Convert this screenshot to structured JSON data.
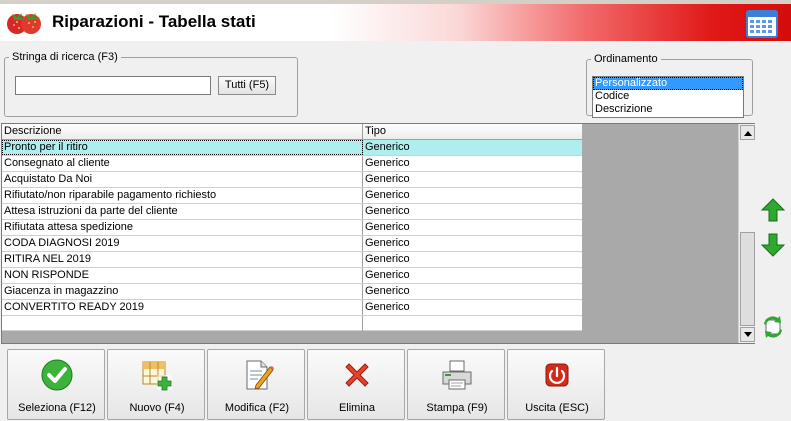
{
  "header": {
    "title": "Riparazioni - Tabella stati"
  },
  "search": {
    "legend": "Stringa di ricerca (F3)",
    "value": "",
    "all_button": "Tutti (F5)"
  },
  "ordering": {
    "legend": "Ordinamento",
    "options": [
      "Personalizzato",
      "Codice",
      "Descrizione"
    ],
    "selected": "Personalizzato"
  },
  "table": {
    "columns": [
      "Descrizione",
      "Tipo"
    ],
    "rows": [
      [
        "Pronto per il ritiro",
        "Generico"
      ],
      [
        "Consegnato al cliente",
        "Generico"
      ],
      [
        "Acquistato Da Noi",
        "Generico"
      ],
      [
        "Rifiutato/non riparabile pagamento richiesto",
        "Generico"
      ],
      [
        "Attesa istruzioni da parte del cliente",
        "Generico"
      ],
      [
        "Rifiutata attesa spedizione",
        "Generico"
      ],
      [
        "CODA DIAGNOSI 2019",
        "Generico"
      ],
      [
        "RITIRA NEL 2019",
        "Generico"
      ],
      [
        "NON RISPONDE",
        "Generico"
      ],
      [
        "Giacenza in magazzino",
        "Generico"
      ],
      [
        "CONVERTITO READY 2019",
        "Generico"
      ]
    ],
    "selected_row": 0
  },
  "toolbar": {
    "select": "Seleziona (F12)",
    "new": "Nuovo (F4)",
    "edit": "Modifica (F2)",
    "delete": "Elimina",
    "print": "Stampa (F9)",
    "exit": "Uscita (ESC)"
  },
  "colors": {
    "header_red": "#d40c0c",
    "selection_cyan": "#aeeeee",
    "list_selection": "#3399ff",
    "arrow_green": "#2ea82e",
    "delete_red": "#e8402a",
    "exit_red": "#d42a1a"
  },
  "icons": {
    "logo": "strawberry-icon",
    "header_right": "calendar-grid-icon",
    "move_up": "arrow-up-icon",
    "move_down": "arrow-down-icon",
    "refresh": "refresh-icon",
    "select": "check-circle-icon",
    "new": "grid-add-icon",
    "edit": "document-edit-icon",
    "delete": "x-icon",
    "print": "printer-icon",
    "exit": "power-icon"
  }
}
